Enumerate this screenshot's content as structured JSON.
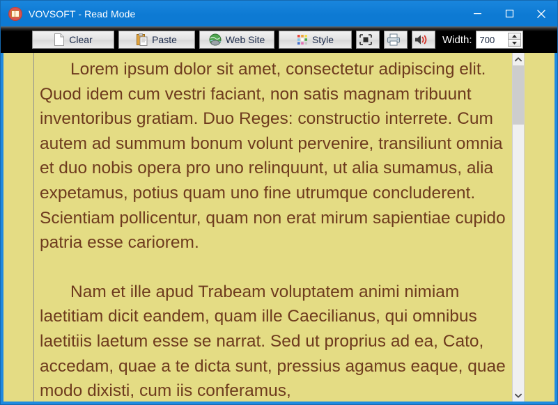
{
  "window": {
    "title": "VOVSOFT - Read Mode",
    "app_icon": "book-icon",
    "controls": {
      "minimize": "minimize-icon",
      "maximize": "maximize-icon",
      "close": "close-icon"
    },
    "accent_color": "#0d7ad3",
    "toolbar_background": "#000000"
  },
  "toolbar": {
    "clear_label": "Clear",
    "paste_label": "Paste",
    "website_label": "Web Site",
    "style_label": "Style",
    "fullscreen_label": "",
    "print_label": "",
    "sound_label": "",
    "width_label": "Width:",
    "width_value": "700",
    "width_placeholder": "700",
    "icons": {
      "clear": "document-icon",
      "paste": "clipboard-icon",
      "website": "globe-icon",
      "style": "color-palette-grid-icon",
      "fullscreen": "fullscreen-icon",
      "print": "printer-icon",
      "sound": "speaker-icon",
      "spin_up": "spinner-up-icon",
      "spin_down": "spinner-down-icon"
    }
  },
  "document": {
    "background_color": "#e4dc84",
    "text_color": "#6e3b1e",
    "paragraphs": [
      "Lorem ipsum dolor sit amet, consectetur adipiscing elit. Quod idem cum vestri faciant, non satis magnam tribuunt inventoribus gratiam. Duo Reges: constructio interrete. Cum autem ad summum bonum volunt pervenire, transiliunt omnia et duo nobis opera pro uno relinquunt, ut alia sumamus, alia expetamus, potius quam uno fine utrumque concluderent. Scientiam pollicentur, quam non erat mirum sapientiae cupido patria esse cariorem.",
      "Nam et ille apud Trabeam voluptatem animi nimiam laetitiam dicit eandem, quam ille Caecilianus, qui omnibus laetitiis laetum esse se narrat. Sed ut proprius ad ea, Cato, accedam, quae a te dicta sunt, pressius agamus eaque, quae modo dixisti, cum iis conferamus,"
    ]
  },
  "scrollbar": {
    "up_arrow": "chevron-up-icon",
    "down_arrow": "chevron-down-icon",
    "thumb": "scroll-thumb"
  }
}
